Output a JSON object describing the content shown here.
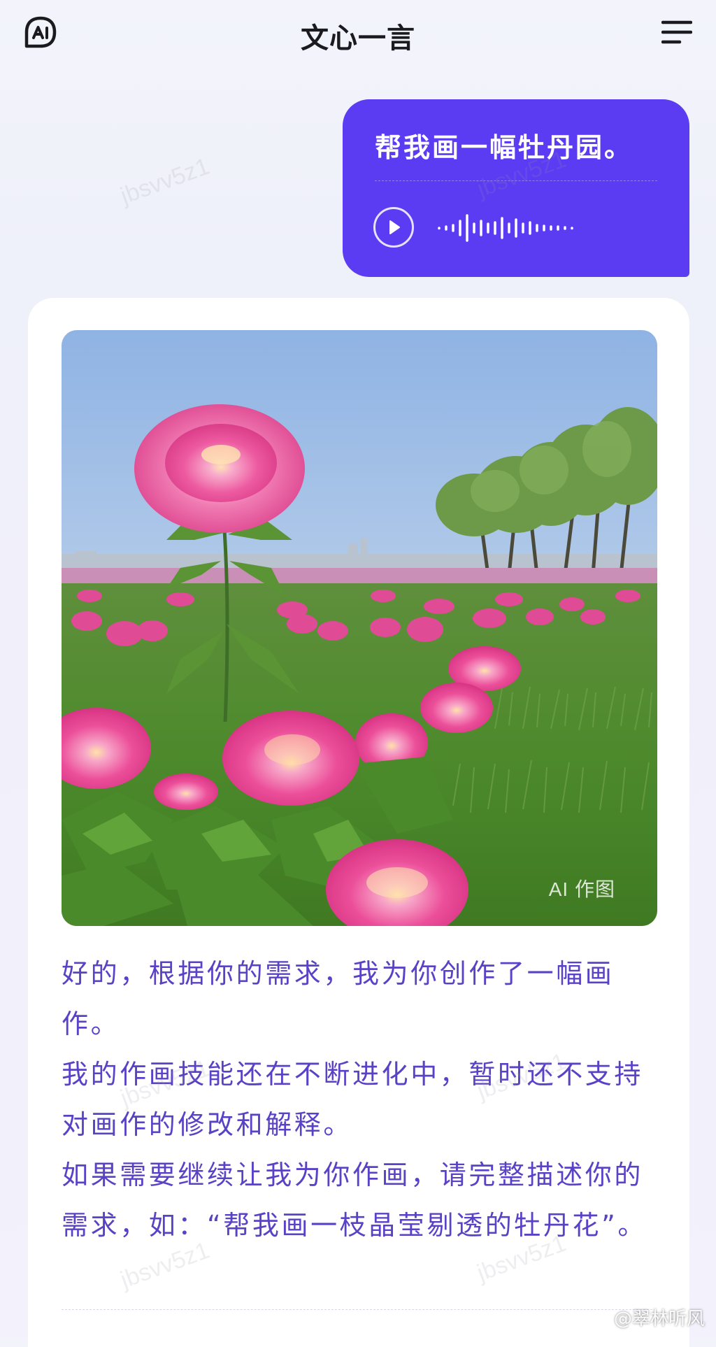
{
  "header": {
    "title": "文心一言",
    "logo_icon": "ai-logo-icon",
    "menu_icon": "menu-icon"
  },
  "user_message": {
    "text": "帮我画一幅牡丹园。",
    "play_icon": "play-icon",
    "bubble_color": "#5b3cf2"
  },
  "response": {
    "image_badge": "AI 作图",
    "paragraphs": [
      "好的，根据你的需求，我为你创作了一幅画作。",
      "我的作画技能还在不断进化中，暂时还不支持对画作的修改和解释。",
      "如果需要继续让我为你作画，请完整描述你的需求，如：“帮我画一枝晶莹剔透的牡丹花”。"
    ],
    "text_color": "#5a42c6"
  },
  "watermarks": {
    "user_id": "jbsvv5z1",
    "weibo_credit": "@翠林听风"
  }
}
